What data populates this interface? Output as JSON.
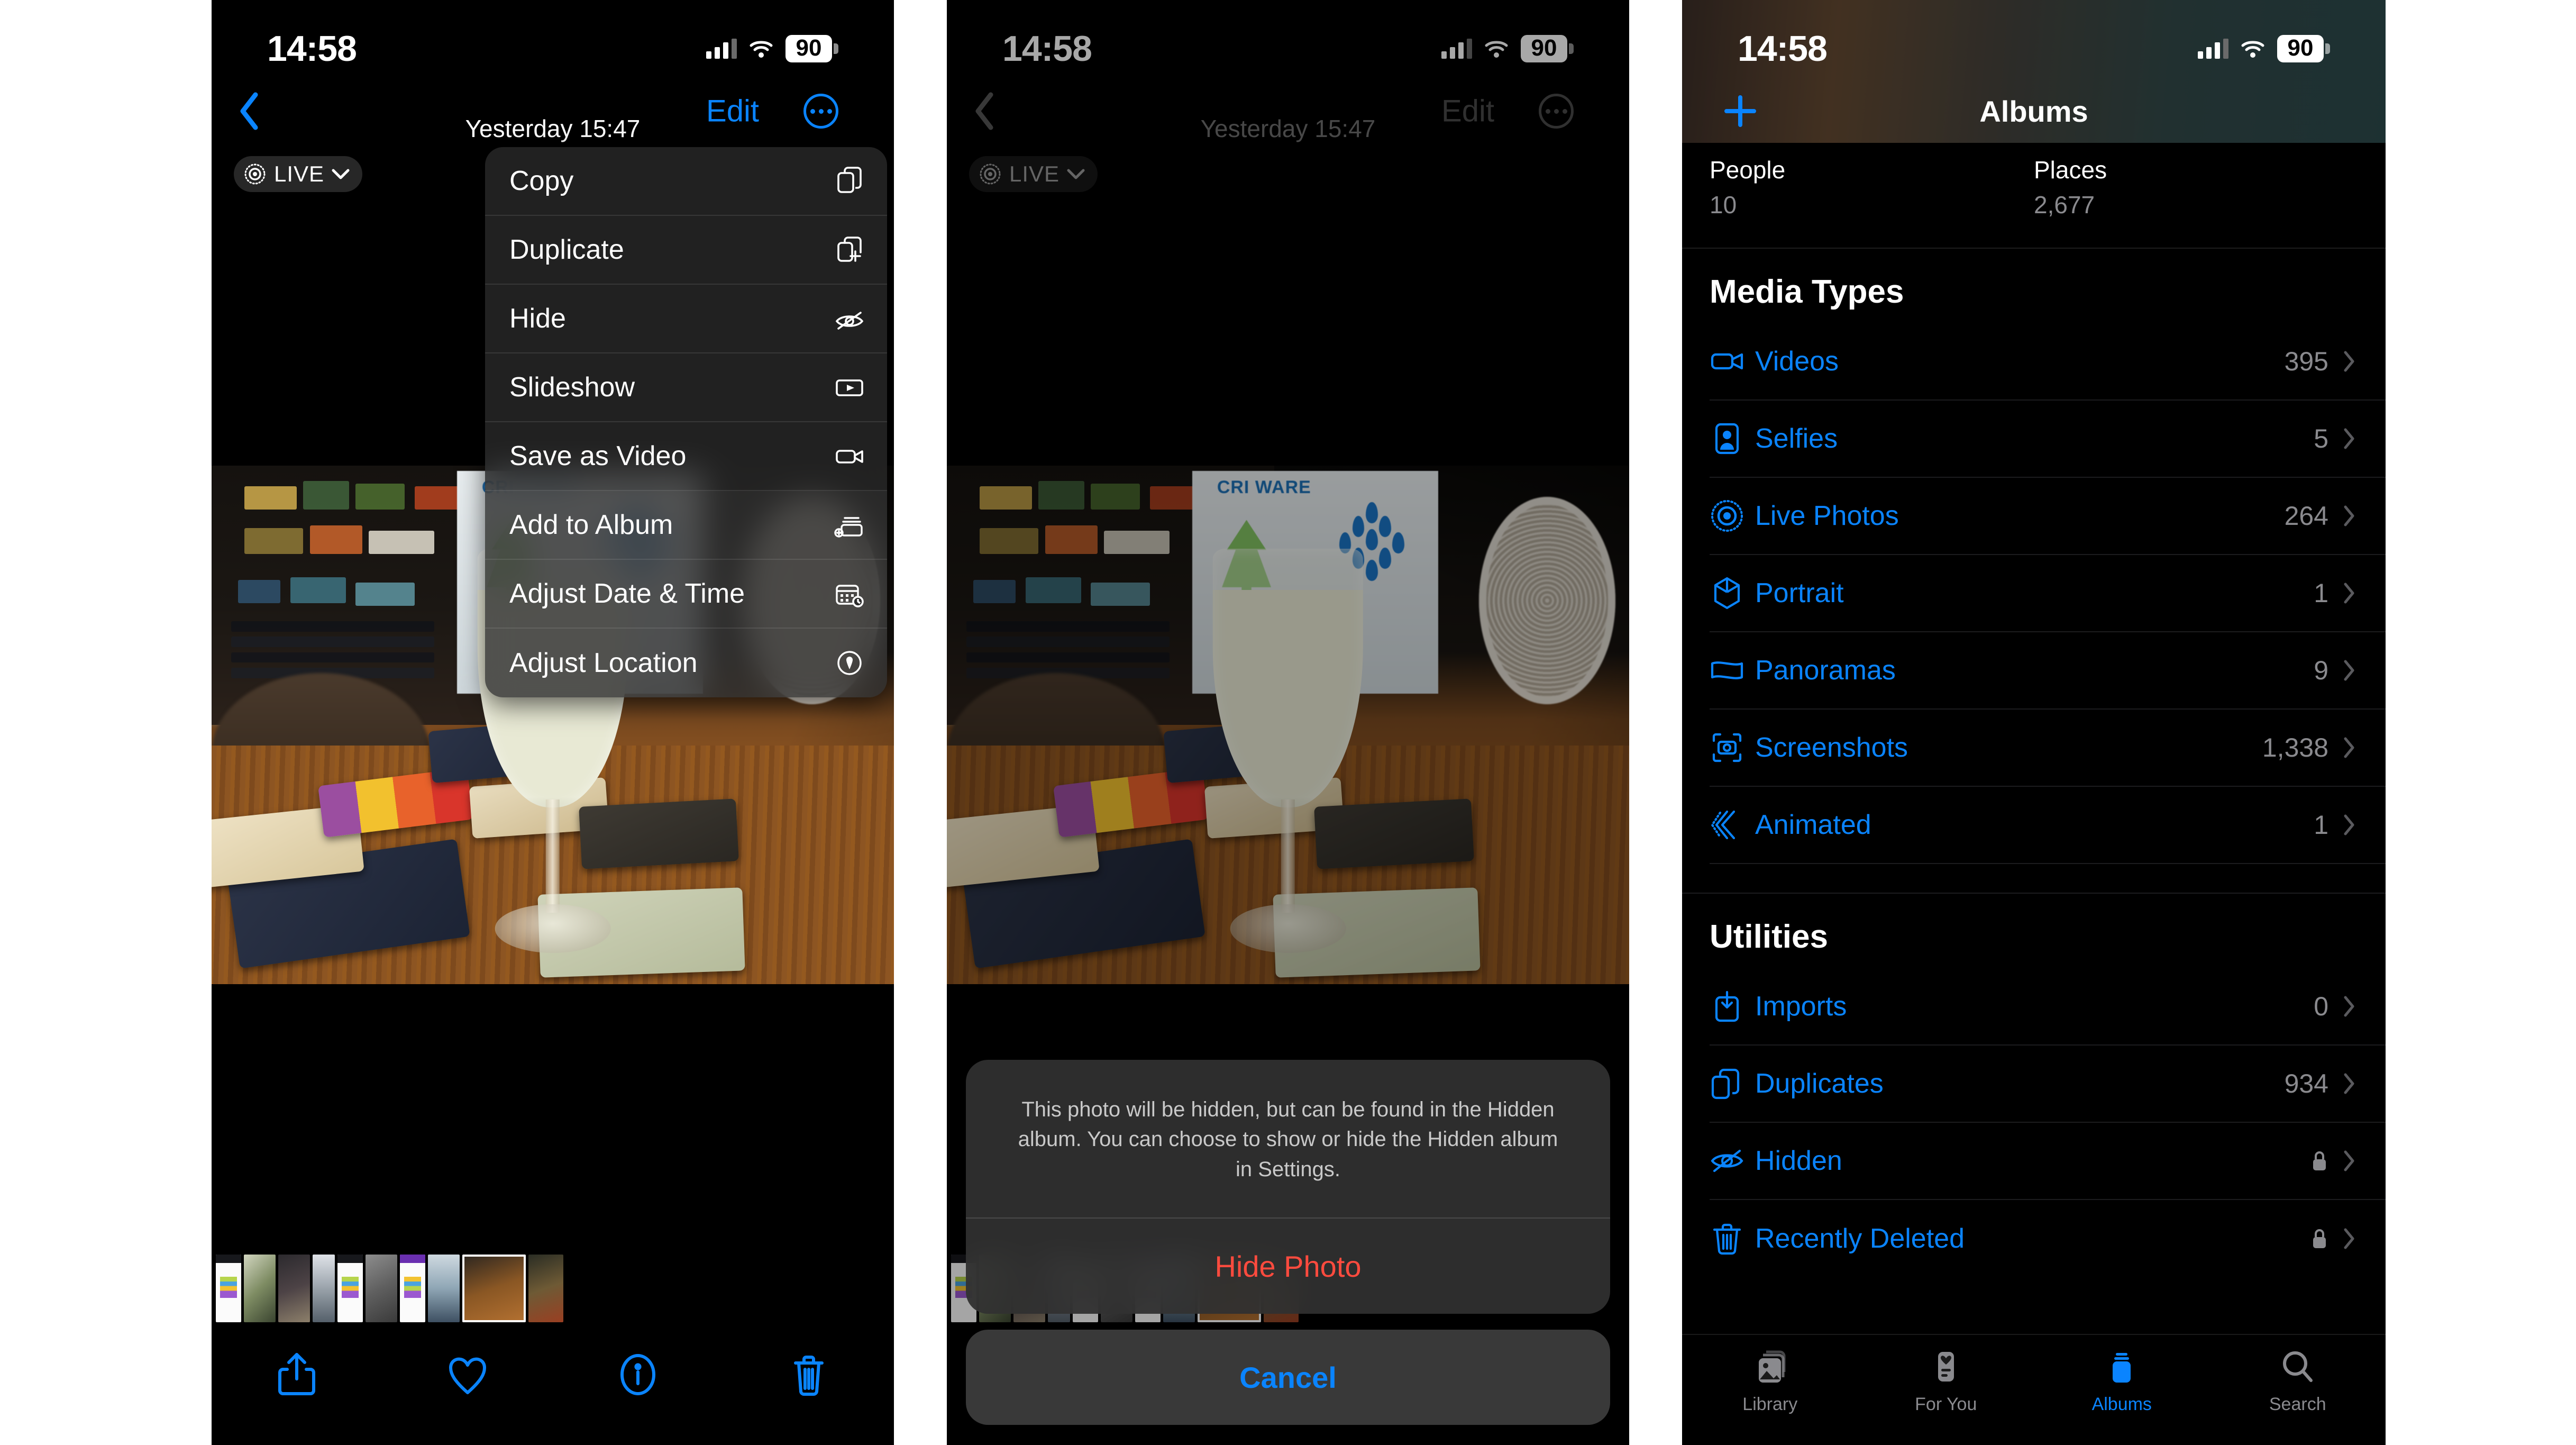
{
  "status_bar": {
    "time": "14:58",
    "battery": "90"
  },
  "colors": {
    "accent_blue": "#0a84ff",
    "destructive_red": "#ff4b3e",
    "secondary_gray": "#8a8a8e"
  },
  "panel1": {
    "nav": {
      "title": "Yesterday  15:47",
      "edit_label": "Edit"
    },
    "live_badge": {
      "label": "LIVE"
    },
    "context_menu": {
      "items": [
        {
          "label": "Copy",
          "icon": "copy-icon"
        },
        {
          "label": "Duplicate",
          "icon": "duplicate-icon"
        },
        {
          "label": "Hide",
          "icon": "eye-slash-icon"
        },
        {
          "label": "Slideshow",
          "icon": "play-rectangle-icon"
        },
        {
          "label": "Save as Video",
          "icon": "video-camera-icon"
        },
        {
          "label": "Add to Album",
          "icon": "add-to-album-icon"
        },
        {
          "label": "Adjust Date & Time",
          "icon": "calendar-clock-icon"
        },
        {
          "label": "Adjust Location",
          "icon": "location-pin-circle-icon"
        }
      ]
    },
    "toolbar": {
      "share_label": "Share",
      "favorite_label": "Favorite",
      "info_label": "Info",
      "delete_label": "Delete"
    }
  },
  "panel2": {
    "nav": {
      "title": "Yesterday  15:47",
      "edit_label": "Edit"
    },
    "live_badge": {
      "label": "LIVE"
    },
    "alert": {
      "message": "This photo will be hidden, but can be found in the Hidden album. You can choose to show or hide the Hidden album in Settings.",
      "confirm_label": "Hide Photo",
      "cancel_label": "Cancel"
    }
  },
  "panel3": {
    "header": {
      "title": "Albums",
      "add_label": "+"
    },
    "people_places": [
      {
        "title": "People",
        "count": "10"
      },
      {
        "title": "Places",
        "count": "2,677"
      }
    ],
    "sections": [
      {
        "heading": "Media Types",
        "rows": [
          {
            "label": "Videos",
            "count": "395",
            "icon": "video-camera-icon",
            "locked": false
          },
          {
            "label": "Selfies",
            "count": "5",
            "icon": "selfie-person-icon",
            "locked": false
          },
          {
            "label": "Live Photos",
            "count": "264",
            "icon": "live-photo-icon",
            "locked": false
          },
          {
            "label": "Portrait",
            "count": "1",
            "icon": "cube-icon",
            "locked": false
          },
          {
            "label": "Panoramas",
            "count": "9",
            "icon": "panorama-icon",
            "locked": false
          },
          {
            "label": "Screenshots",
            "count": "1,338",
            "icon": "screenshot-icon",
            "locked": false
          },
          {
            "label": "Animated",
            "count": "1",
            "icon": "animated-icon",
            "locked": false
          }
        ]
      },
      {
        "heading": "Utilities",
        "rows": [
          {
            "label": "Imports",
            "count": "0",
            "icon": "import-icon",
            "locked": false
          },
          {
            "label": "Duplicates",
            "count": "934",
            "icon": "duplicate-icon",
            "locked": false
          },
          {
            "label": "Hidden",
            "count": "",
            "icon": "eye-slash-icon",
            "locked": true
          },
          {
            "label": "Recently Deleted",
            "count": "",
            "icon": "trash-icon",
            "locked": true
          }
        ]
      }
    ],
    "tabs": [
      {
        "label": "Library",
        "icon": "photo-stack-icon",
        "active": false
      },
      {
        "label": "For You",
        "icon": "for-you-icon",
        "active": false
      },
      {
        "label": "Albums",
        "icon": "albums-icon",
        "active": true
      },
      {
        "label": "Search",
        "icon": "search-icon",
        "active": false
      }
    ]
  }
}
